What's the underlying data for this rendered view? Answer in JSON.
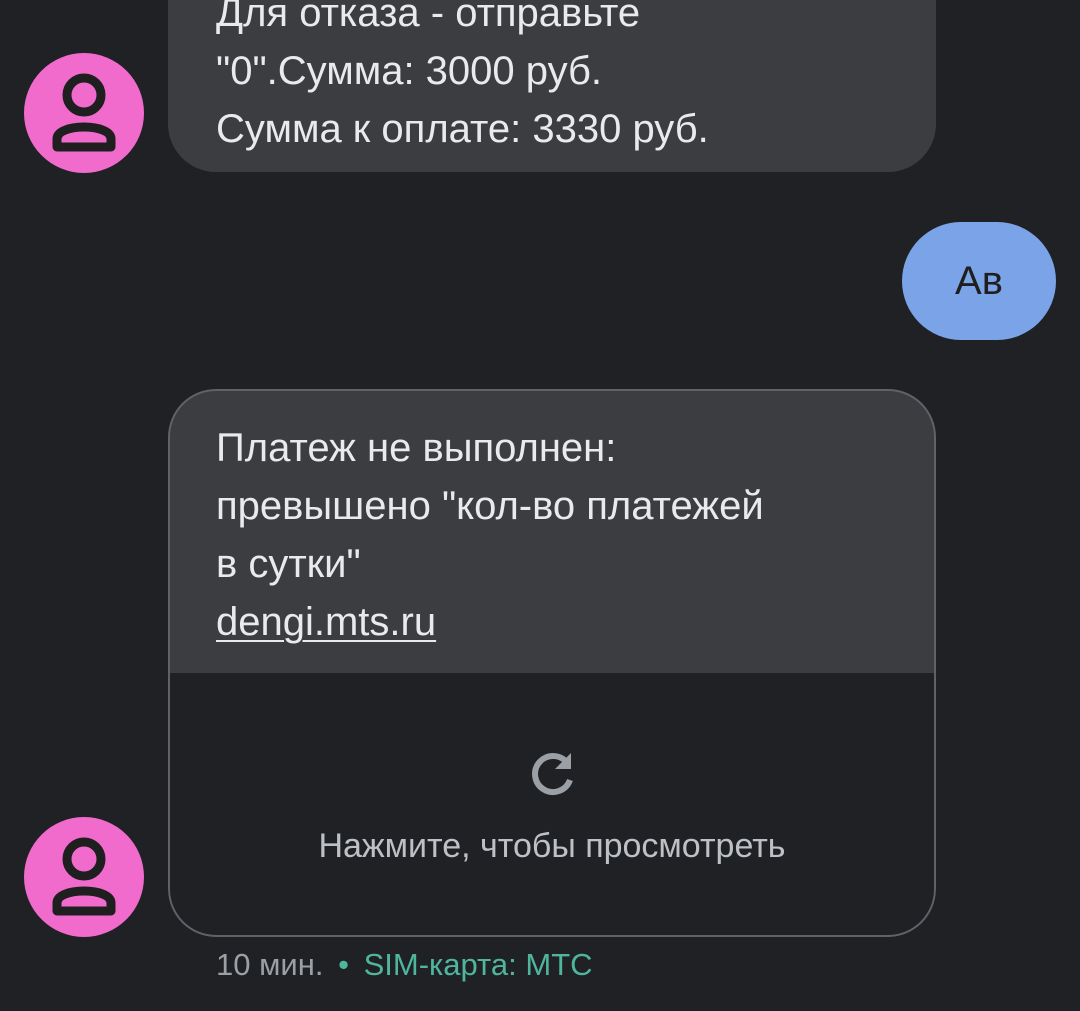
{
  "messages": {
    "incoming_1": {
      "lines": [
        "Для отказа - отправьте",
        "\"0\".Сумма: 3000 руб.",
        "Сумма к оплате: 3330 руб."
      ]
    },
    "outgoing_1": {
      "text": "Ав"
    },
    "incoming_2": {
      "lines": [
        "Платеж не выполнен:",
        "превышено \"кол-во платежей",
        "в сутки\""
      ],
      "link": "dengi.mts.ru",
      "preview": {
        "icon": "refresh-icon",
        "label": "Нажмите, чтобы просмотреть"
      }
    }
  },
  "meta": {
    "time": "10 мин.",
    "separator": "•",
    "sim": "SIM-карта: МТС"
  },
  "colors": {
    "background": "#202124",
    "incoming_bubble": "#3c3d41",
    "outgoing_bubble": "#7ba4e8",
    "avatar": "#f06bcc",
    "sim_text": "#4fb59c"
  },
  "icons": {
    "avatar": "person-icon"
  }
}
